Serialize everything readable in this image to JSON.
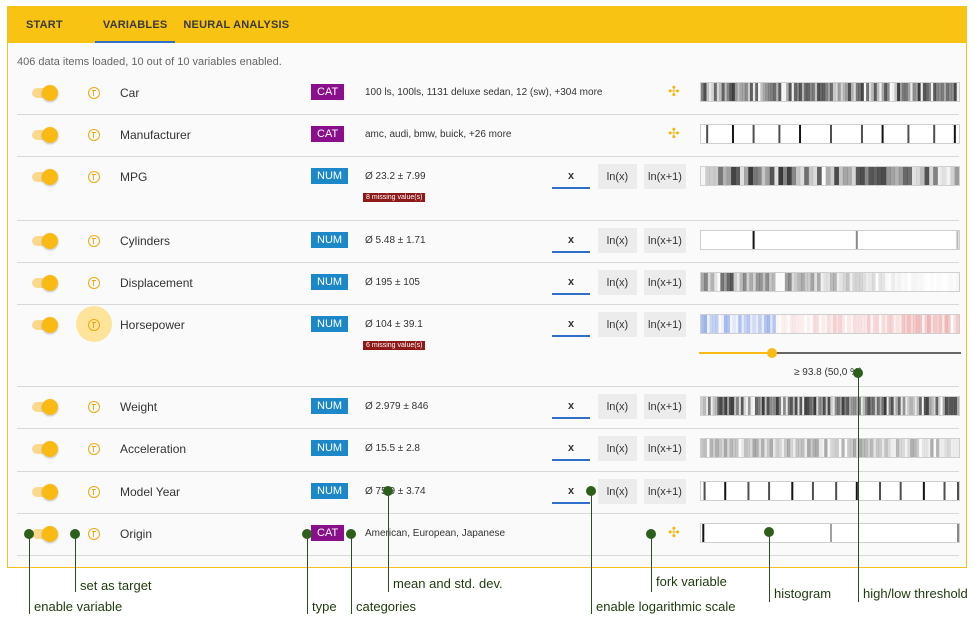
{
  "tabs": [
    {
      "label": "START"
    },
    {
      "label": "VARIABLES"
    },
    {
      "label": "NEURAL ANALYSIS"
    }
  ],
  "status_text": "406 data items loaded, 10 out of 10 variables enabled.",
  "colors": {
    "topbar": "#f9c313",
    "toggle": "#f9bb13",
    "cat_badge": "#8a0f8a",
    "num_badge": "#1c88c7",
    "missing": "#8e1919",
    "active_tab": "#2f6fc9",
    "callout": "#2d5f1a"
  },
  "scale_options": [
    "x",
    "ln(x)",
    "ln(x+1)"
  ],
  "variables": [
    {
      "name": "Car",
      "type": "CAT",
      "info": "100 ls, 100ls, 1131 deluxe sedan, 12 (sw), +304 more",
      "fork": true,
      "enabled": true,
      "is_target": false
    },
    {
      "name": "Manufacturer",
      "type": "CAT",
      "info": "amc, audi, bmw, buick, +26 more",
      "fork": true,
      "enabled": true,
      "is_target": false
    },
    {
      "name": "MPG",
      "type": "NUM",
      "info": "Ø 23.2  ± 7.99",
      "missing": "8 missing value(s)",
      "scale": "x",
      "enabled": true,
      "is_target": false
    },
    {
      "name": "Cylinders",
      "type": "NUM",
      "info": "Ø 5.48  ± 1.71",
      "scale": "x",
      "enabled": true,
      "is_target": false
    },
    {
      "name": "Displacement",
      "type": "NUM",
      "info": "Ø 195  ± 105",
      "scale": "x",
      "enabled": true,
      "is_target": false
    },
    {
      "name": "Horsepower",
      "type": "NUM",
      "info": "Ø 104  ± 39.1",
      "missing": "6 missing value(s)",
      "scale": "x",
      "enabled": true,
      "is_target": true,
      "threshold_label": "≥ 93.8 (50,0 %)",
      "threshold_fraction": 0.28
    },
    {
      "name": "Weight",
      "type": "NUM",
      "info": "Ø 2.979  ± 846",
      "scale": "x",
      "enabled": true,
      "is_target": false
    },
    {
      "name": "Acceleration",
      "type": "NUM",
      "info": "Ø 15.5  ± 2.8",
      "scale": "x",
      "enabled": true,
      "is_target": false
    },
    {
      "name": "Model Year",
      "type": "NUM",
      "info": "Ø 75.9  ± 3.74",
      "scale": "x",
      "enabled": true,
      "is_target": false
    },
    {
      "name": "Origin",
      "type": "CAT",
      "info": "American, European, Japanese",
      "fork": true,
      "enabled": true,
      "is_target": false
    }
  ],
  "callouts": [
    "enable variable",
    "set as target",
    "type",
    "categories",
    "mean and std. dev.",
    "enable logarithmic scale",
    "fork variable",
    "histogram",
    "high/low threshold"
  ]
}
